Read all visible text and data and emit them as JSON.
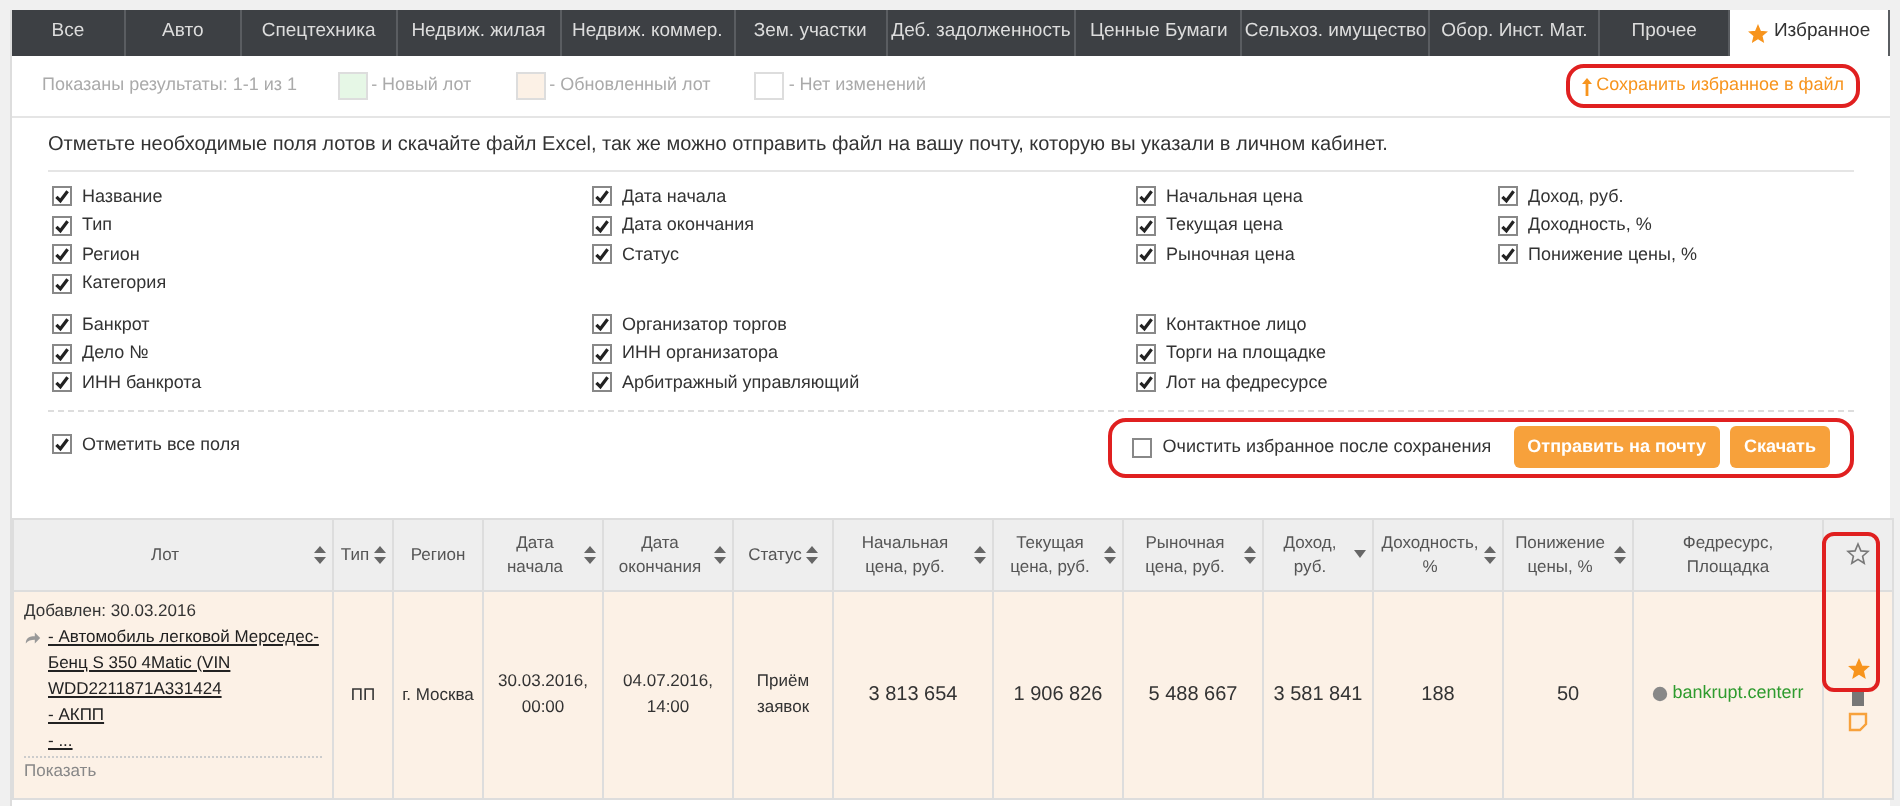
{
  "tabs": [
    {
      "label": "Все",
      "selected": false,
      "kind": "category"
    },
    {
      "label": "Авто",
      "selected": false,
      "kind": "category"
    },
    {
      "label": "Спецтехника",
      "selected": false,
      "kind": "category"
    },
    {
      "label": "Недвиж. жилая",
      "selected": false,
      "kind": "category"
    },
    {
      "label": "Недвиж. коммер.",
      "selected": false,
      "kind": "category"
    },
    {
      "label": "Зем. участки",
      "selected": false,
      "kind": "category"
    },
    {
      "label": "Деб. задолженность",
      "selected": false,
      "kind": "category"
    },
    {
      "label": "Ценные Бумаги",
      "selected": false,
      "kind": "category"
    },
    {
      "label": "Сельхоз. имущество",
      "selected": false,
      "kind": "category"
    },
    {
      "label": "Обор. Инст. Мат.",
      "selected": false,
      "kind": "category"
    },
    {
      "label": "Прочее",
      "selected": false,
      "kind": "category"
    },
    {
      "label": "Избранное",
      "selected": true,
      "kind": "favorites"
    }
  ],
  "results": "Показаны результаты: 1-1 из 1",
  "legend": [
    {
      "label": "- Новый лот",
      "color": "#e6f7e6"
    },
    {
      "label": "- Обновленный лот",
      "color": "#fcf1e6"
    },
    {
      "label": "- Нет изменений",
      "color": "#ffffff"
    }
  ],
  "save_link": {
    "label": "Сохранить избранное в файл",
    "highlighted": true
  },
  "instructions": "Отметьте необходимые поля лотов и скачайте файл Excel, так же можно отправить файл на вашу почту, которую вы указали в личном кабинет.",
  "field_groups": [
    {
      "columns": [
        [
          {
            "label": "Название",
            "checked": true
          },
          {
            "label": "Тип",
            "checked": true
          },
          {
            "label": "Регион",
            "checked": true
          },
          {
            "label": "Категория",
            "checked": true
          }
        ],
        [
          {
            "label": "Дата начала",
            "checked": true
          },
          {
            "label": "Дата окончания",
            "checked": true
          },
          {
            "label": "Статус",
            "checked": true
          }
        ],
        [
          {
            "label": "Начальная цена",
            "checked": true
          },
          {
            "label": "Текущая цена",
            "checked": true
          },
          {
            "label": "Рыночная цена",
            "checked": true
          }
        ],
        [
          {
            "label": "Доход, руб.",
            "checked": true
          },
          {
            "label": "Доходность, %",
            "checked": true
          },
          {
            "label": "Понижение цены, %",
            "checked": true
          }
        ]
      ]
    },
    {
      "columns": [
        [
          {
            "label": "Банкрот",
            "checked": true
          },
          {
            "label": "Дело №",
            "checked": true
          },
          {
            "label": "ИНН банкрота",
            "checked": true
          }
        ],
        [
          {
            "label": "Организатор торгов",
            "checked": true
          },
          {
            "label": "ИНН организатора",
            "checked": true
          },
          {
            "label": "Арбитражный управляющий",
            "checked": true
          }
        ],
        [
          {
            "label": "Контактное лицо",
            "checked": true
          },
          {
            "label": "Торги на площадке",
            "checked": true
          },
          {
            "label": "Лот на федресурсе",
            "checked": true
          }
        ],
        []
      ]
    }
  ],
  "select_all": {
    "label": "Отметить все поля",
    "checked": true
  },
  "export_panel": {
    "highlighted": true,
    "clear_option": {
      "label": "Очистить избранное после сохранения",
      "checked": false
    },
    "buttons": [
      "Отправить на почту",
      "Скачать"
    ]
  },
  "table": {
    "columns": [
      {
        "label": "Лот",
        "kind": "sortable"
      },
      {
        "label": "Тип",
        "kind": "sortable"
      },
      {
        "label": "Регион",
        "kind": "plain"
      },
      {
        "label": "Дата начала",
        "kind": "sortable"
      },
      {
        "label": "Дата окончания",
        "kind": "sortable"
      },
      {
        "label": "Статус",
        "kind": "sortable"
      },
      {
        "label": "Начальная цена, руб.",
        "kind": "sortable"
      },
      {
        "label": "Текущая цена, руб.",
        "kind": "sortable"
      },
      {
        "label": "Рыночная цена, руб.",
        "kind": "sortable"
      },
      {
        "label": "Доход, руб.",
        "kind": "sorted_desc"
      },
      {
        "label": "Доходность, %",
        "kind": "sortable"
      },
      {
        "label": "Понижение цены, %",
        "kind": "sortable"
      },
      {
        "label": "Федресурс, Площадка",
        "kind": "plain"
      },
      {
        "kind": "star"
      }
    ],
    "star_column_highlighted": true,
    "rows": [
      {
        "kind": "updated",
        "cells": [
          {
            "kind": "lot",
            "added": "Добавлен: 30.03.2016",
            "lot_lines": [
              "- Автомобиль легковой Мерседес-Бенц S 350 4Matic (VIN WDD2211871A331424",
              "- АКПП",
              "- ..."
            ],
            "show_more": "Показать"
          },
          "ПП",
          "г. Москва",
          "30.03.2016, 00:00",
          "04.07.2016, 14:00",
          "Приём заявок",
          "3 813 654",
          "1 906 826",
          "5 488 667",
          "3 581 841",
          "188",
          "50",
          {
            "kind": "link",
            "text": "bankrupt.centerr"
          },
          {
            "kind": "actions",
            "favorite": true
          }
        ]
      }
    ]
  }
}
